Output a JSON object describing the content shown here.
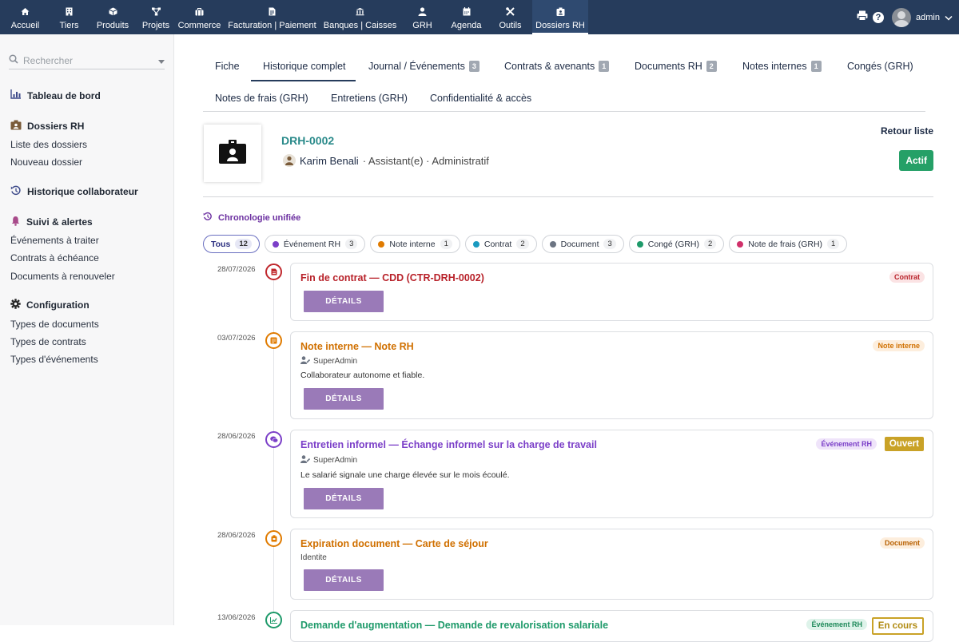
{
  "topnav": {
    "items": [
      {
        "label": "Accueil",
        "icon": "home-icon"
      },
      {
        "label": "Tiers",
        "icon": "building-icon"
      },
      {
        "label": "Produits",
        "icon": "cube-icon"
      },
      {
        "label": "Projets",
        "icon": "project-icon"
      },
      {
        "label": "Commerce",
        "icon": "briefcase-icon"
      },
      {
        "label": "Facturation | Paiement",
        "icon": "invoice-icon"
      },
      {
        "label": "Banques | Caisses",
        "icon": "bank-icon"
      },
      {
        "label": "GRH",
        "icon": "user-icon"
      },
      {
        "label": "Agenda",
        "icon": "calendar-icon"
      },
      {
        "label": "Outils",
        "icon": "tools-icon"
      },
      {
        "label": "Dossiers RH",
        "icon": "id-badge-icon"
      }
    ],
    "active": "Dossiers RH",
    "user": "admin"
  },
  "sidebar": {
    "search_placeholder": "Rechercher",
    "dashboard": "Tableau de bord",
    "dossiers": {
      "title": "Dossiers RH",
      "items": [
        "Liste des dossiers",
        "Nouveau dossier"
      ]
    },
    "historique": "Historique collaborateur",
    "suivi": {
      "title": "Suivi & alertes",
      "items": [
        "Événements à traiter",
        "Contrats à échéance",
        "Documents à renouveler"
      ]
    },
    "config": {
      "title": "Configuration",
      "items": [
        "Types de documents",
        "Types de contrats",
        "Types d'événements"
      ]
    }
  },
  "tabs": {
    "row1": [
      {
        "label": "Fiche",
        "badge": ""
      },
      {
        "label": "Historique complet",
        "badge": ""
      },
      {
        "label": "Journal / Événements",
        "badge": "3"
      },
      {
        "label": "Contrats & avenants",
        "badge": "1"
      },
      {
        "label": "Documents RH",
        "badge": "2"
      },
      {
        "label": "Notes internes",
        "badge": "1"
      },
      {
        "label": "Congés (GRH)",
        "badge": ""
      }
    ],
    "row2": [
      {
        "label": "Notes de frais (GRH)"
      },
      {
        "label": "Entretiens (GRH)"
      },
      {
        "label": "Confidentialité & accès"
      }
    ],
    "active": "Historique complet"
  },
  "record": {
    "ref": "DRH-0002",
    "name": "Karim Benali",
    "job": "· Assistant(e) · Administratif",
    "back": "Retour liste",
    "status": "Actif"
  },
  "timeline": {
    "title": "Chronologie unifiée",
    "filters": [
      {
        "label": "Tous",
        "count": "12",
        "color": ""
      },
      {
        "label": "Événement RH",
        "count": "3",
        "color": "#7b3fc8"
      },
      {
        "label": "Note interne",
        "count": "1",
        "color": "#e07b00"
      },
      {
        "label": "Contrat",
        "count": "2",
        "color": "#1a9ac0"
      },
      {
        "label": "Document",
        "count": "3",
        "color": "#6c7482"
      },
      {
        "label": "Congé (GRH)",
        "count": "2",
        "color": "#1e9a6a"
      },
      {
        "label": "Note de frais (GRH)",
        "count": "1",
        "color": "#d0306a"
      }
    ],
    "events": [
      {
        "date": "28/07/2026",
        "title": "Fin de contrat — CDD (CTR-DRH-0002)",
        "tag": "Contrat",
        "author": "",
        "desc": "",
        "button": "DÉTAILS",
        "status": ""
      },
      {
        "date": "03/07/2026",
        "title": "Note interne — Note RH",
        "tag": "Note interne",
        "author": "SuperAdmin",
        "desc": "Collaborateur autonome et fiable.",
        "button": "DÉTAILS",
        "status": ""
      },
      {
        "date": "28/06/2026",
        "title": "Entretien informel — Échange informel sur la charge de travail",
        "tag": "Événement RH",
        "author": "SuperAdmin",
        "desc": "Le salarié signale une charge élevée sur le mois écoulé.",
        "button": "DÉTAILS",
        "status": "Ouvert"
      },
      {
        "date": "28/06/2026",
        "title": "Expiration document — Carte de séjour",
        "tag": "Document",
        "author": "",
        "desc": "Identite",
        "button": "DÉTAILS",
        "status": ""
      },
      {
        "date": "13/06/2026",
        "title": "Demande d'augmentation — Demande de revalorisation salariale",
        "tag": "Événement RH",
        "author": "",
        "desc": "",
        "button": "",
        "status": "En cours"
      }
    ]
  },
  "colors": {
    "topbar": "#263c5c",
    "accent": "#2a8a8a",
    "button": "#9a7ab8",
    "actif": "#25a067"
  }
}
